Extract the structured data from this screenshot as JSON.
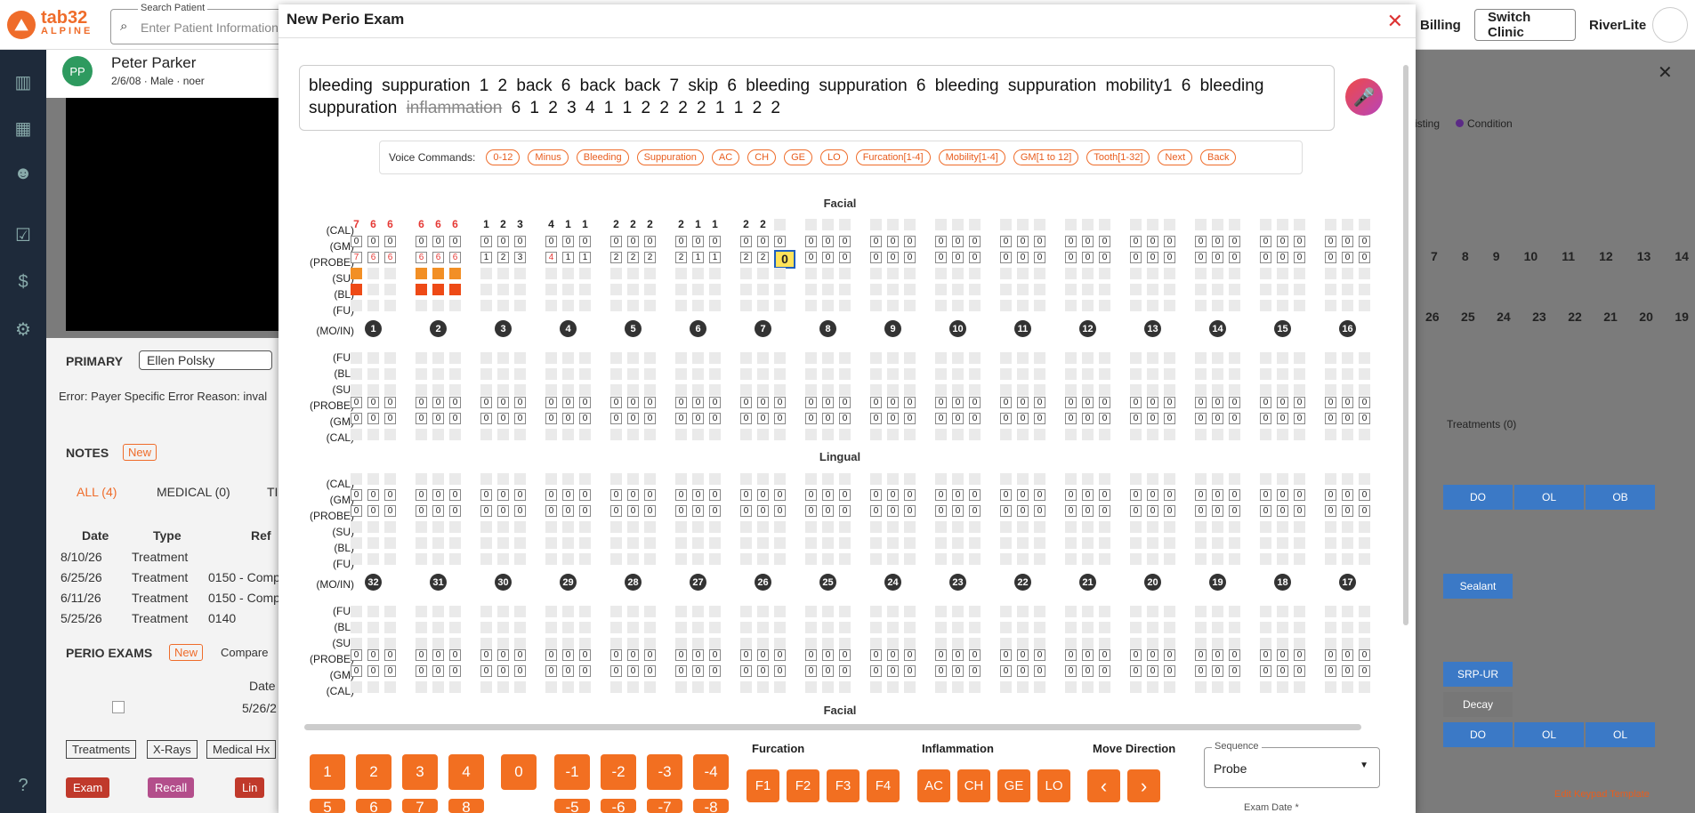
{
  "app": {
    "logo_main": "tab32",
    "logo_sub": "ALPINE",
    "search_label": "Search Patient",
    "search_placeholder": "Enter Patient Information",
    "billing": "Billing",
    "switch_clinic": "Switch Clinic",
    "user": "RiverLite"
  },
  "patient": {
    "initials": "PP",
    "name": "Peter Parker",
    "dob": "2/6/08",
    "sex": "Male",
    "extra": "noer"
  },
  "background": {
    "primary_label": "PRIMARY",
    "primary_value": "Ellen Polsky",
    "error": "Error: Payer Specific Error Reason: inval",
    "notes": "NOTES",
    "new": "New",
    "tab_all": "ALL (4)",
    "tab_medical": "MEDICAL (0)",
    "tab_t": "TI",
    "cols": [
      "Date",
      "Type",
      "Ref"
    ],
    "rows": [
      [
        "8/10/26",
        "Treatment",
        ""
      ],
      [
        "6/25/26",
        "Treatment",
        "0150 - Comp"
      ],
      [
        "6/11/26",
        "Treatment",
        "0150 - Comp"
      ],
      [
        "5/25/26",
        "Treatment",
        "0140"
      ]
    ],
    "perio": "PERIO EXAMS",
    "compare": "Compare",
    "date_col": "Date",
    "date_val": "5/26/2",
    "btns": [
      "Treatments",
      "X-Rays",
      "Medical Hx"
    ],
    "exam": "Exam",
    "recall": "Recall",
    "lin": "Lin",
    "legend_existing": "isting",
    "legend_condition": "Condition",
    "treatments": "Treatments (0)",
    "edit_tpl": "Edit Keypad Template",
    "tooth_row_upper": [
      "7",
      "8",
      "9",
      "10",
      "11",
      "12",
      "13",
      "14"
    ],
    "tooth_row_lower": [
      "26",
      "25",
      "24",
      "23",
      "22",
      "21",
      "20",
      "19"
    ],
    "rt_labels": [
      "DO",
      "OL",
      "OB",
      "Sealant",
      "SRP-UR",
      "Decay",
      "DO",
      "OL",
      "OL"
    ]
  },
  "modal": {
    "title": "New Perio Exam",
    "transcript_pre": "bleeding suppuration 1 2 back 6 back back 7 skip 6 bleeding suppuration 6 bleeding suppuration mobility1 6 bleeding suppuration",
    "transcript_strike": "inflammation",
    "transcript_post": "6 1 2 3 4 1 1 2 2 2 2 1 1 2 2",
    "voice_label": "Voice Commands:",
    "voice_cmds": [
      "0-12",
      "Minus",
      "Bleeding",
      "Suppuration",
      "AC",
      "CH",
      "GE",
      "LO",
      "Furcation[1-4]",
      "Mobility[1-4]",
      "GM[1 to 12]",
      "Tooth[1-32]",
      "Next",
      "Back"
    ],
    "facial": "Facial",
    "lingual": "Lingual",
    "labels_top": [
      "(CAL)",
      "(GM)",
      "(PROBE)",
      "(SU)",
      "(BL)",
      "(FU)",
      "(MO/IN)"
    ],
    "labels_bottom": [
      "(FU)",
      "(BL)",
      "(SU)",
      "(PROBE)",
      "(GM)",
      "(CAL)"
    ],
    "upper_teeth": [
      "1",
      "2",
      "3",
      "4",
      "5",
      "6",
      "7",
      "8",
      "9",
      "10",
      "11",
      "12",
      "13",
      "14",
      "15",
      "16"
    ],
    "lower_teeth": [
      "32",
      "31",
      "30",
      "29",
      "28",
      "27",
      "26",
      "25",
      "24",
      "23",
      "22",
      "21",
      "20",
      "19",
      "18",
      "17"
    ],
    "cal_values": [
      [
        "7",
        "6",
        "6"
      ],
      [
        "6",
        "6",
        "6"
      ],
      [
        "1",
        "2",
        "3"
      ],
      [
        "4",
        "1",
        "1"
      ],
      [
        "2",
        "2",
        "2"
      ],
      [
        "2",
        "1",
        "1"
      ],
      [
        "2",
        "2",
        ""
      ]
    ],
    "probe_values": [
      [
        "7",
        "6",
        "6"
      ],
      [
        "6",
        "6",
        "6"
      ],
      [
        "1",
        "2",
        "3"
      ],
      [
        "4",
        "1",
        "1"
      ],
      [
        "2",
        "2",
        "2"
      ],
      [
        "2",
        "1",
        "1"
      ],
      [
        "2",
        "2",
        "0"
      ]
    ],
    "su_flags": [
      [
        1,
        0,
        0
      ],
      [
        1,
        1,
        1
      ]
    ],
    "bl_flags": [
      [
        1,
        0,
        0
      ],
      [
        1,
        1,
        1
      ]
    ],
    "zero": "0",
    "keypad_nums": [
      "1",
      "2",
      "3",
      "4",
      "0",
      "-1",
      "-2",
      "-3",
      "-4"
    ],
    "keypad_nums2": [
      "5",
      "6",
      "7",
      "8",
      "-5",
      "-6",
      "-7",
      "-8"
    ],
    "furcation_label": "Furcation",
    "furcation": [
      "F1",
      "F2",
      "F3",
      "F4"
    ],
    "inflammation_label": "Inflammation",
    "inflammation": [
      "AC",
      "CH",
      "GE",
      "LO"
    ],
    "move_label": "Move Direction",
    "move": [
      "‹",
      "›"
    ],
    "sequence_label": "Sequence",
    "sequence_value": "Probe",
    "exam_date_label": "Exam Date *"
  },
  "colors": {
    "accent": "#f26f21",
    "su": "#f28f25",
    "bl": "#ee4a16",
    "cal_red": "#e53935"
  }
}
